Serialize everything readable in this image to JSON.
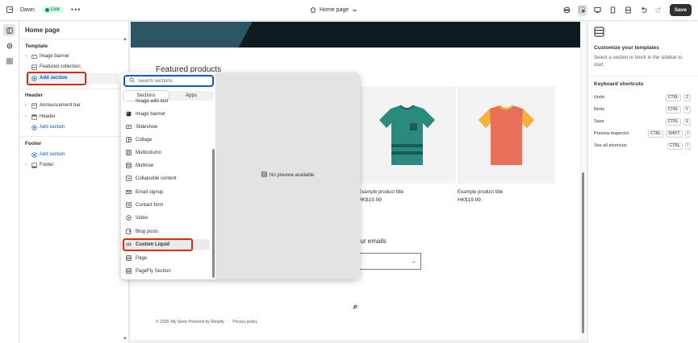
{
  "topbar": {
    "theme_name": "Dawn",
    "live_badge": "Live",
    "more_icon": "more-horizontal-icon",
    "page_selector": "Home page",
    "save_label": "Save"
  },
  "sidebar": {
    "title": "Home page",
    "template": {
      "label": "Template",
      "items": [
        {
          "label": "Image banner",
          "icon": "image-banner-icon"
        },
        {
          "label": "Featured collection",
          "icon": "featured-collection-icon"
        }
      ],
      "add_label": "Add section"
    },
    "header": {
      "label": "Header",
      "items": [
        {
          "label": "Announcement bar",
          "icon": "announcement-icon"
        },
        {
          "label": "Header",
          "icon": "header-icon"
        }
      ],
      "add_label": "Add section"
    },
    "footer": {
      "label": "Footer",
      "add_label": "Add section",
      "items": [
        {
          "label": "Footer",
          "icon": "footer-icon"
        }
      ]
    }
  },
  "popup": {
    "search_placeholder": "Search sections",
    "tabs": [
      {
        "label": "Sections",
        "active": true
      },
      {
        "label": "Apps",
        "active": false
      }
    ],
    "clipped_item": "Image with text",
    "items": [
      "Image banner",
      "Slideshow",
      "Collage",
      "Multicolumn",
      "Multirow",
      "Collapsible content",
      "Email signup",
      "Contact form",
      "Video",
      "Blog posts",
      "Custom Liquid",
      "Page",
      "PageFly Section"
    ],
    "no_preview": "No preview available"
  },
  "preview": {
    "featured_title": "Featured products",
    "products": [
      {
        "title": "Example product title",
        "price": "HK$19.99",
        "color": "#2a8a7e"
      },
      {
        "title": "Example product title",
        "price": "HK$19.99",
        "color": "#e8705a"
      }
    ],
    "email_title": "our emails",
    "paypal": "P",
    "footer_copyright": "© 2025, My Store Powered by Shopify",
    "footer_privacy": "Privacy policy"
  },
  "rightpanel": {
    "title": "Customize your templates",
    "description": "Select a section or block in the sidebar to start.",
    "shortcuts_title": "Keyboard shortcuts",
    "shortcuts": [
      {
        "label": "Undo",
        "keys": [
          "CTRL",
          "Z"
        ]
      },
      {
        "label": "Redo",
        "keys": [
          "CTRL",
          "Y"
        ]
      },
      {
        "label": "Save",
        "keys": [
          "CTRL",
          "S"
        ]
      },
      {
        "label": "Preview inspector",
        "keys": [
          "CTRL",
          "SHIFT",
          "I"
        ]
      },
      {
        "label": "See all shortcuts",
        "keys": [
          "CTRL",
          "/"
        ]
      }
    ]
  },
  "colors": {
    "accent_blue": "#005bd3",
    "highlight_red": "#d72c0d",
    "live_green": "#29845a"
  }
}
